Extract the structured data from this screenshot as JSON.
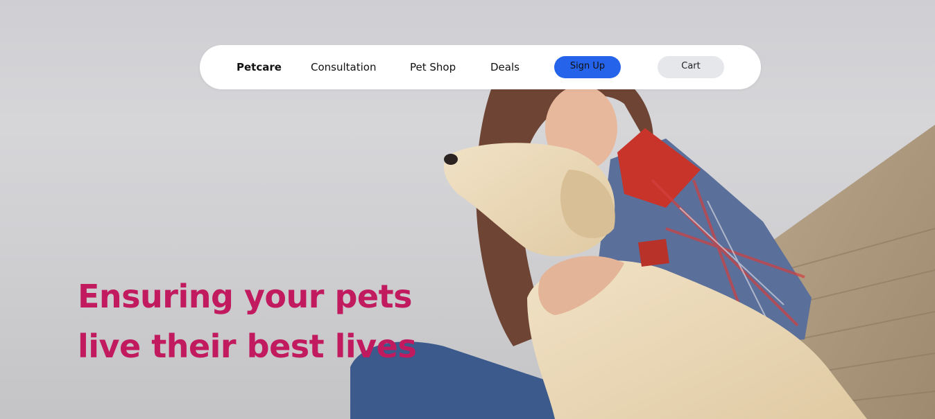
{
  "nav": {
    "brand": "Petcare",
    "links": [
      "Consultation",
      "Pet Shop",
      "Deals"
    ],
    "signup_label": "Sign Up",
    "cart_label": "Cart"
  },
  "hero": {
    "headline_lines": [
      "Ensuring your pets",
      "live their best lives"
    ]
  },
  "colors": {
    "accent": "#2563eb",
    "headline": "#c11a5e",
    "nav_bg": "#ffffff",
    "cart_bg": "#e6e7ea"
  }
}
